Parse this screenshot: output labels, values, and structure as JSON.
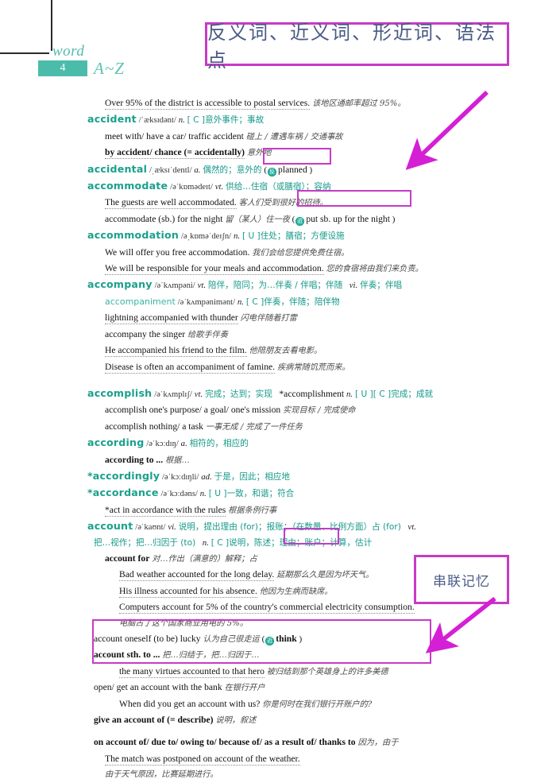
{
  "header": {
    "word_label": "word",
    "number": "4",
    "range": "A~Z"
  },
  "annotations": {
    "title_note": "反义词、近义词、形近词、语法点",
    "chain_note": "串联记忆"
  },
  "colors": {
    "headword": "#1aa08c",
    "chinese": "#16998a",
    "annotation_border": "#c63bc6",
    "annotation_text": "#4a5b86",
    "arrow": "#d51fd5",
    "header_box": "#4cbcaa"
  },
  "badges": {
    "antonym": "反",
    "synonym": "近"
  },
  "lines": {
    "l0": "Over 95% of the district is accessible to postal services.",
    "l0_cn": "该地区通邮率超过 95%。",
    "accident_hw": "accident",
    "accident_ph": "/ˈæksɪdənt/",
    "accident_pos": "n.",
    "accident_cn": "[ C ]意外事件；事故",
    "accident_ex1": "meet with/ have a car/ traffic accident",
    "accident_ex1_cn": "碰上 / 遭遇车祸 / 交通事故",
    "accident_ex2": "by accident/ chance (= accidentally)",
    "accident_ex2_cn": "意外地",
    "accidental_hw": "accidental",
    "accidental_ph": "/ˌæksɪˈdentl/",
    "accidental_pos": "a.",
    "accidental_cn": "偶然的；意外的",
    "accidental_anto": "planned",
    "accommodate_hw": "accommodate",
    "accommodate_ph": "/əˈkɒmədeɪt/",
    "accommodate_pos": "vt.",
    "accommodate_cn": "供给…住宿（或膳宿）；容纳",
    "accommodate_ex1": "The guests are well accommodated.",
    "accommodate_ex1_cn": "客人们受到很好的招待。",
    "accommodate_ex2": "accommodate (sb.) for the night",
    "accommodate_ex2_cn": "留（某人）住一夜",
    "accommodate_syn": "put sb. up for the night",
    "accommodation_hw": "accommodation",
    "accommodation_ph": "/əˌkɒməˈdeɪʃn/",
    "accommodation_pos": "n.",
    "accommodation_cn": "[ U ]住处；膳宿；方便设施",
    "accommodation_ex1": "We will offer you free accommodation.",
    "accommodation_ex1_cn": "我们会给您提供免费住宿。",
    "accommodation_ex2": "We will be responsible for your meals and accommodation.",
    "accommodation_ex2_cn": "您的食宿将由我们来负责。",
    "accompany_hw": "accompany",
    "accompany_ph": "/əˈkʌmpəni/",
    "accompany_pos1": "vt.",
    "accompany_cn1": "陪伴，陪同；为…伴奏 / 伴唱；伴随",
    "accompany_pos2": "vi.",
    "accompany_cn2": "伴奏；伴唱",
    "accompaniment_hw": "accompaniment",
    "accompaniment_ph": "/əˈkʌmpənimənt/",
    "accompaniment_pos": "n.",
    "accompaniment_cn": "[ C ]伴奏，伴随；陪伴物",
    "accompany_ex1": "lightning accompanied with thunder",
    "accompany_ex1_cn": "闪电伴随着打雷",
    "accompany_ex2": "accompany the singer",
    "accompany_ex2_cn": "给歌手伴奏",
    "accompany_ex3": "He accompanied his friend to the film.",
    "accompany_ex3_cn": "他陪朋友去看电影。",
    "accompany_ex4": "Disease is often an accompaniment of famine.",
    "accompany_ex4_cn": "疾病常随饥荒而来。",
    "accomplish_hw": "accomplish",
    "accomplish_ph": "/əˈkʌmplɪʃ/",
    "accomplish_pos": "vt.",
    "accomplish_cn": "完成；达到；实现",
    "accomplishment_hw": "*accomplishment",
    "accomplishment_pos": "n.",
    "accomplishment_cn": "[ U ][ C ]完成；成就",
    "accomplish_ex1": "accomplish one's purpose/ a goal/ one's mission",
    "accomplish_ex1_cn": "实现目标 / 完成使命",
    "accomplish_ex2": "accomplish nothing/ a task",
    "accomplish_ex2_cn": "一事无成 / 完成了一件任务",
    "according_hw": "according",
    "according_ph": "/əˈkɔːdɪŋ/",
    "according_pos": "a.",
    "according_cn": "相符的，相应的",
    "according_ex1": "according to ...",
    "according_ex1_cn": "根据…",
    "accordingly_hw": "*accordingly",
    "accordingly_ph": "/əˈkɔːdɪŋli/",
    "accordingly_pos": "ad.",
    "accordingly_cn": "于是，因此；相应地",
    "accordance_hw": "*accordance",
    "accordance_ph": "/əˈkɔːdəns/",
    "accordance_pos": "n.",
    "accordance_cn": "[ U ]一致，和谐；符合",
    "accordance_ex1": "*act in accordance with the rules",
    "accordance_ex1_cn": "根据条例行事",
    "account_hw": "account",
    "account_ph": "/əˈkaʊnt/",
    "account_pos1": "vi.",
    "account_cn1": "说明，提出理由 (for)；报账；（在数量、比例方面）占 (for)",
    "account_pos2": "vt.",
    "account_cn2": "把…视作；把…归因于 (to)",
    "account_pos3": "n.",
    "account_cn3": "[ C ]说明，陈述；理由；账户；计算，估计",
    "account_ph1": "account for",
    "account_ph1_cn": "对…作出（满意的）解释；占",
    "account_ex1": "Bad weather accounted for the long delay.",
    "account_ex1_cn": "延期那么久是因为坏天气。",
    "account_ex2": "His illness accounted for his absence.",
    "account_ex2_cn": "他因为生病而缺席。",
    "account_ex3": "Computers account for 5% of the country's commercial electricity consumption.",
    "account_ex3_cn": "电脑占了这个国家商业用电的 5%。",
    "account_ph2": "account oneself (to be) lucky",
    "account_ph2_cn": "认为自己很走运",
    "account_ph2_syn": "think",
    "account_ph3": "account sth. to ...",
    "account_ph3_cn": "把…归结于，把…归因于…",
    "account_ex4": "the many virtues accounted to that hero",
    "account_ex4_cn": "被归结到那个英雄身上的许多美德",
    "account_ph4": "open/ get an account with the bank",
    "account_ph4_cn": "在银行开户",
    "account_ex5": "When did you get an account with us?",
    "account_ex5_cn": "你是何时在我们银行开账户的?",
    "account_ph5": "give an account of (= describe)",
    "account_ph5_cn": "说明，叙述",
    "onaccount_ph": "on account of/ due to/ owing to/ because of/ as a result of/ thanks to",
    "onaccount_cn": "因为，由于",
    "onaccount_ex1": "The match was postponed on account of the weather.",
    "onaccount_ex1_cn": "由于天气原因，比赛延期进行。"
  }
}
